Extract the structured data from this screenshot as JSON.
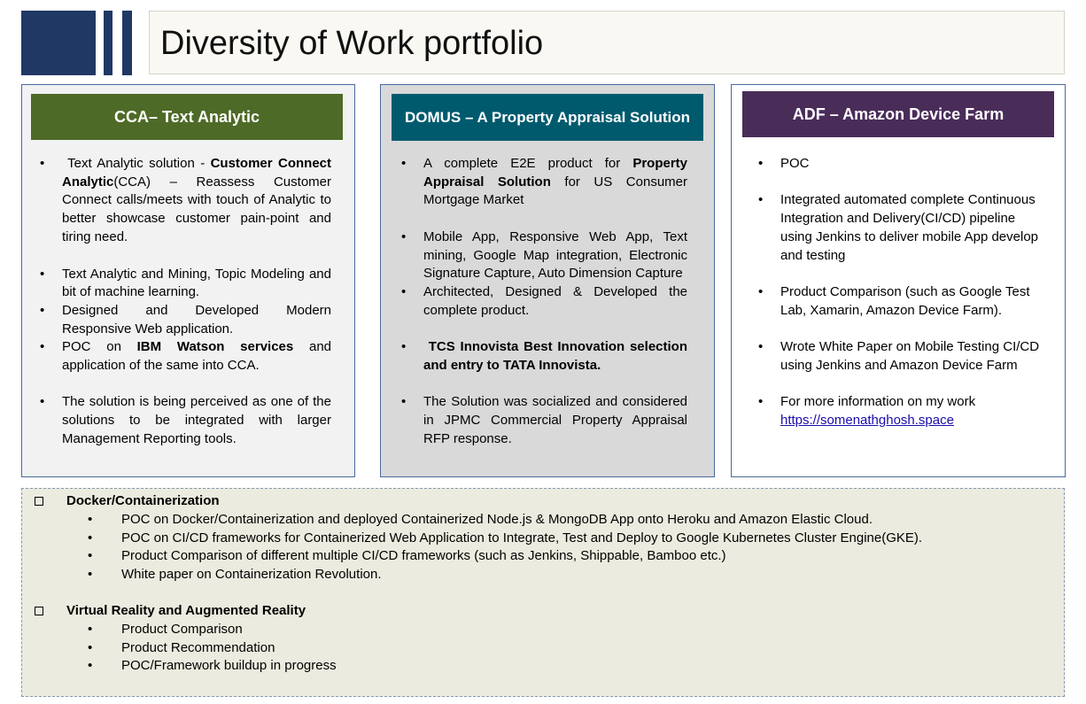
{
  "title": "Diversity of Work portfolio",
  "colors": {
    "deco": "#1f3864",
    "cca_header": "#4e6a27",
    "domus_header": "#005a6e",
    "adf_header": "#4a2c59",
    "link": "#1a0dab"
  },
  "cca": {
    "header": "CCA– Text Analytic",
    "b1_pre": " Text Analytic solution - ",
    "b1_bold": "Customer Connect Analytic",
    "b1_post": "(CCA) – Reassess Customer Connect calls/meets with touch of Analytic to better showcase customer pain-point and tiring need.",
    "b2": "Text Analytic and Mining, Topic Modeling and bit of machine learning.",
    "b3": "Designed and Developed Modern Responsive Web application.",
    "b4_pre": "POC on ",
    "b4_bold": "IBM Watson services",
    "b4_post": " and application of the same into CCA.",
    "b5": "The solution is being perceived as one of the solutions to be integrated with larger Management Reporting tools."
  },
  "domus": {
    "header": "DOMUS – A Property Appraisal Solution",
    "b1_pre": "A complete E2E product for ",
    "b1_bold": "Property Appraisal Solution",
    "b1_post": " for US Consumer Mortgage Market",
    "b2": "Mobile App, Responsive Web App, Text mining, Google Map integration, Electronic Signature Capture, Auto Dimension Capture",
    "b3": "Architected, Designed & Developed the complete product.",
    "b4_bold": " TCS Innovista Best Innovation selection and entry to TATA Innovista.",
    "b5": "The Solution was socialized and considered in JPMC Commercial Property Appraisal RFP response."
  },
  "adf": {
    "header": "ADF – Amazon Device Farm",
    "b1": "POC",
    "b2": "Integrated automated complete Continuous Integration and Delivery(CI/CD) pipeline using Jenkins to deliver mobile App develop and testing",
    "b3": "Product Comparison (such as Google Test Lab, Xamarin,  Amazon Device Farm).",
    "b4": "Wrote White Paper on Mobile Testing CI/CD using Jenkins and Amazon Device Farm",
    "b5": "For more information on my work",
    "link": "https://somenathghosh.space"
  },
  "docker": {
    "heading": "Docker/Containerization",
    "items": [
      "POC on Docker/Containerization and deployed Containerized Node.js & MongoDB App onto Heroku and Amazon Elastic Cloud.",
      "POC on CI/CD frameworks for Containerized Web Application to Integrate, Test and Deploy to Google Kubernetes Cluster Engine(GKE).",
      "Product Comparison of different multiple CI/CD frameworks (such as Jenkins, Shippable, Bamboo etc.)",
      "White paper on Containerization Revolution."
    ]
  },
  "vr": {
    "heading": "Virtual Reality and Augmented Reality",
    "items": [
      "Product Comparison",
      "Product Recommendation",
      "POC/Framework buildup in progress"
    ]
  }
}
